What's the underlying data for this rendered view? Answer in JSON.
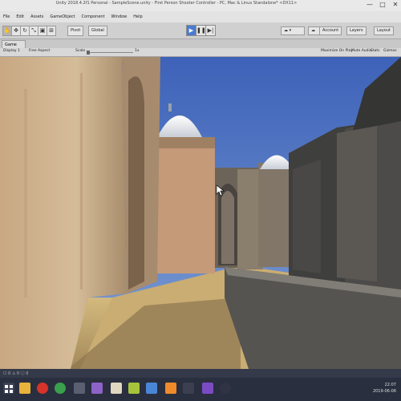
{
  "window": {
    "title": "Unity 2018.4.2f1 Personal - SampleScene.unity - First Person Shooter Controller - PC, Mac & Linux Standalone* <DX11>",
    "controls": [
      "—",
      "□",
      "✕"
    ]
  },
  "menu": [
    "File",
    "Edit",
    "Assets",
    "GameObject",
    "Component",
    "Window",
    "Help"
  ],
  "toolbar": {
    "tools": [
      "hand-icon",
      "move-icon",
      "rotate-icon",
      "scale-icon",
      "rect-icon",
      "transform-icon"
    ],
    "pivot_label": "Pivot",
    "global_label": "Global",
    "play_buttons": [
      "play-icon",
      "pause-icon",
      "step-icon"
    ],
    "account_label": "Account",
    "layers_label": "Layers",
    "layout_label": "Layout"
  },
  "game_tab": {
    "label": "Game"
  },
  "game_bar": {
    "display": "Display 1",
    "aspect": "Free Aspect",
    "scale_label": "Scale",
    "scale_value": "1x",
    "maximize": "Maximize On Play",
    "mute": "Mute Audio",
    "stats": "Stats",
    "gizmos": "Gizmos"
  },
  "status_strip": {
    "left": "☐ 0  ⚠ 0  ⓘ 0"
  },
  "clock": {
    "time": "22:07",
    "date": "2019-06-06"
  }
}
